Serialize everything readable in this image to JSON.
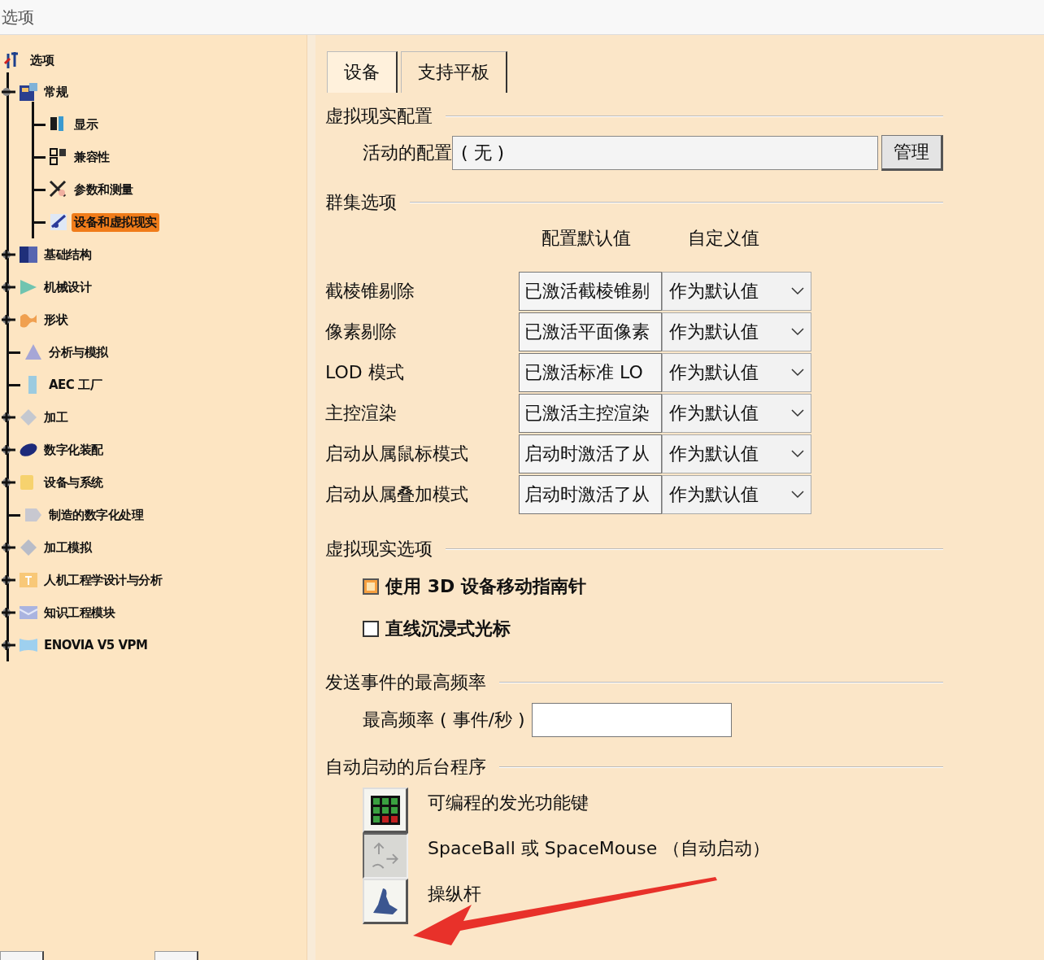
{
  "window": {
    "title": "选项"
  },
  "tree": {
    "label": "选项",
    "children": [
      {
        "label": "常规",
        "expandable": true,
        "expanded": true,
        "selected": false,
        "children": [
          {
            "label": "显示",
            "selected": false
          },
          {
            "label": "兼容性",
            "selected": false
          },
          {
            "label": "参数和测量",
            "selected": false
          },
          {
            "label": "设备和虚拟现实",
            "selected": true
          }
        ]
      },
      {
        "label": "基础结构",
        "expandable": true,
        "expanded": false,
        "selected": false
      },
      {
        "label": "机械设计",
        "expandable": true,
        "expanded": false,
        "selected": false
      },
      {
        "label": "形状",
        "expandable": true,
        "expanded": false,
        "selected": false
      },
      {
        "label": "分析与模拟",
        "expandable": false,
        "expanded": false,
        "selected": false
      },
      {
        "label": "AEC 工厂",
        "expandable": false,
        "expanded": false,
        "selected": false
      },
      {
        "label": "加工",
        "expandable": true,
        "expanded": false,
        "selected": false
      },
      {
        "label": "数字化装配",
        "expandable": true,
        "expanded": false,
        "selected": false
      },
      {
        "label": "设备与系统",
        "expandable": true,
        "expanded": false,
        "selected": false
      },
      {
        "label": "制造的数字化处理",
        "expandable": false,
        "expanded": false,
        "selected": false
      },
      {
        "label": "加工模拟",
        "expandable": true,
        "expanded": false,
        "selected": false
      },
      {
        "label": "人机工程学设计与分析",
        "expandable": true,
        "expanded": false,
        "selected": false
      },
      {
        "label": "知识工程模块",
        "expandable": true,
        "expanded": false,
        "selected": false
      },
      {
        "label": "ENOVIA V5 VPM",
        "expandable": true,
        "expanded": false,
        "selected": false
      }
    ]
  },
  "tabs": [
    {
      "label": "设备",
      "selected": true
    },
    {
      "label": "支持平板",
      "selected": false
    }
  ],
  "vr_config": {
    "title": "虚拟现实配置",
    "label": "活动的配置",
    "value": "( 无 )",
    "button": "管理"
  },
  "cluster": {
    "title": "群集选项",
    "columns": [
      "配置默认值",
      "自定义值"
    ],
    "rows": [
      {
        "label": "截棱锥剔除",
        "default": "已激活截棱锥剔",
        "custom": "作为默认值"
      },
      {
        "label": "像素剔除",
        "default": "已激活平面像素",
        "custom": "作为默认值"
      },
      {
        "label": "LOD 模式",
        "default": "已激活标准 LO",
        "custom": "作为默认值"
      },
      {
        "label": "主控渲染",
        "default": "已激活主控渲染",
        "custom": "作为默认值"
      },
      {
        "label": "启动从属鼠标模式",
        "default": "启动时激活了从",
        "custom": "作为默认值"
      },
      {
        "label": "启动从属叠加模式",
        "default": "启动时激活了从",
        "custom": "作为默认值"
      }
    ]
  },
  "vr_options": {
    "title": "虚拟现实选项",
    "items": [
      {
        "label": "使用 3D 设备移动指南针",
        "checked": true
      },
      {
        "label": "直线沉浸式光标",
        "checked": false
      }
    ]
  },
  "frequency": {
    "title": "发送事件的最高频率",
    "label": "最高频率 ( 事件/秒 )"
  },
  "autostart": {
    "title": "自动启动的后台程序",
    "items": [
      {
        "label": "可编程的发光功能键",
        "pressed": false
      },
      {
        "label": "SpaceBall 或 SpaceMouse （自动启动）",
        "pressed": true
      },
      {
        "label": "操纵杆",
        "pressed": false
      }
    ]
  }
}
